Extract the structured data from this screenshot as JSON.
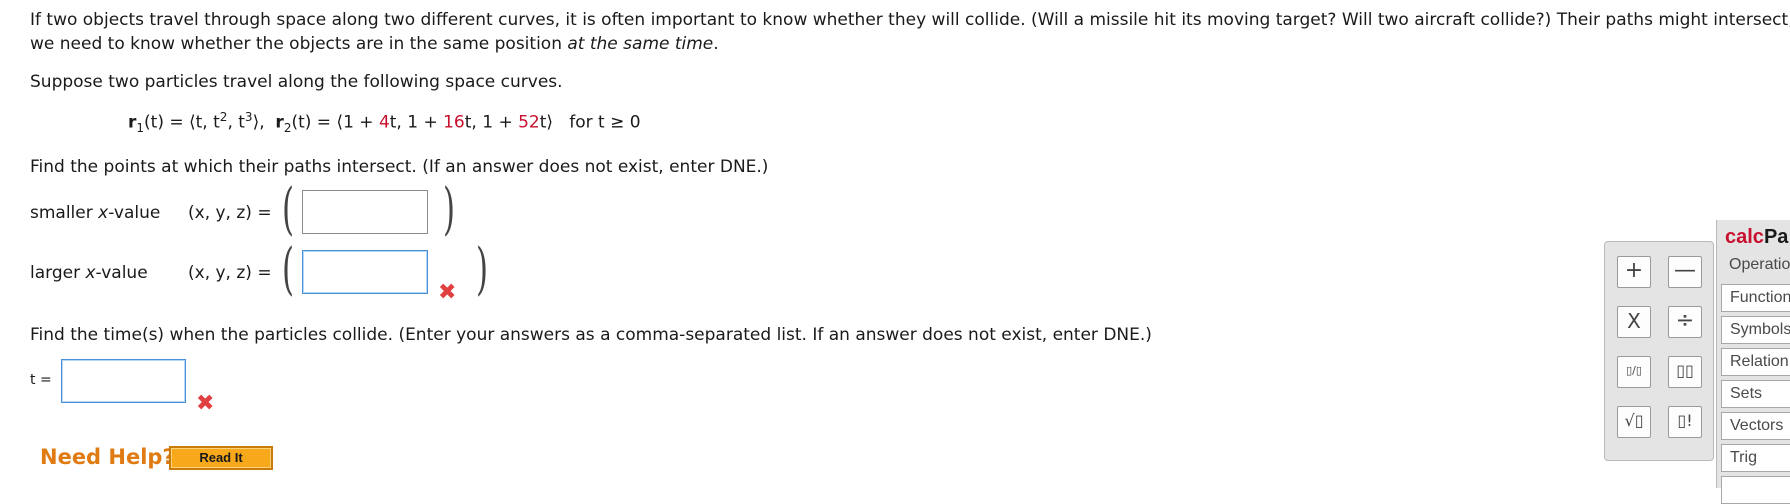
{
  "intro": {
    "line1": "If two objects travel through space along two different curves, it is often important to know whether they will collide. (Will a missile hit its moving target? Will two aircraft collide?) Their paths might intersect, but",
    "line2_pre": "we need to know whether the objects are in the same position ",
    "line2_em": "at the same time",
    "line2_post": "."
  },
  "suppose": "Suppose two particles travel along the following space curves.",
  "formula": {
    "r1": "r",
    "r1_sub": "1",
    "r1_expr_a": "(t) = ⟨t, t",
    "r1_pow2": "2",
    "r1_expr_b": ", t",
    "r1_pow3": "3",
    "r1_expr_c": "⟩,",
    "r2": "r",
    "r2_sub": "2",
    "r2_expr_a": "(t) = ⟨1 + ",
    "r2_c1": "4",
    "r2_expr_b": "t, 1 + ",
    "r2_c2": "16",
    "r2_expr_c": "t, 1 + ",
    "r2_c3": "52",
    "r2_expr_d": "t⟩",
    "condition": "for t ≥ 0"
  },
  "find_points": "Find the points at which their paths intersect. (If an answer does not exist, enter DNE.)",
  "rows": [
    {
      "label_pre": "smaller ",
      "label_var": "x",
      "label_post": "-value",
      "coord": "(x, y, z)  =",
      "value": "",
      "status": ""
    },
    {
      "label_pre": "larger ",
      "label_var": "x",
      "label_post": "-value",
      "coord": "(x, y, z)  =",
      "value": "",
      "status": "incorrect"
    }
  ],
  "find_time": "Find the time(s) when the particles collide. (Enter your answers as a comma-separated list. If an answer does not exist, enter DNE.)",
  "time": {
    "label": "t =",
    "value": "",
    "status": "incorrect"
  },
  "help": {
    "title": "Need Help?",
    "button": "Read It"
  },
  "calcpad": {
    "title_red": "calc",
    "title_black": "Pa",
    "buttons": [
      "+",
      "—",
      "X",
      "÷",
      "▯/▯",
      "▯▯",
      "√▯",
      "▯!"
    ],
    "menu": [
      "Operatio",
      "Function",
      "Symbols",
      "Relation",
      "Sets",
      "Vectors",
      "Trig"
    ]
  },
  "colors": {
    "accent_red": "#c8102e",
    "help_orange": "#e07b14",
    "button_orange": "#f7a81b",
    "incorrect": "#e04040",
    "focus_blue": "#4a90d9"
  }
}
